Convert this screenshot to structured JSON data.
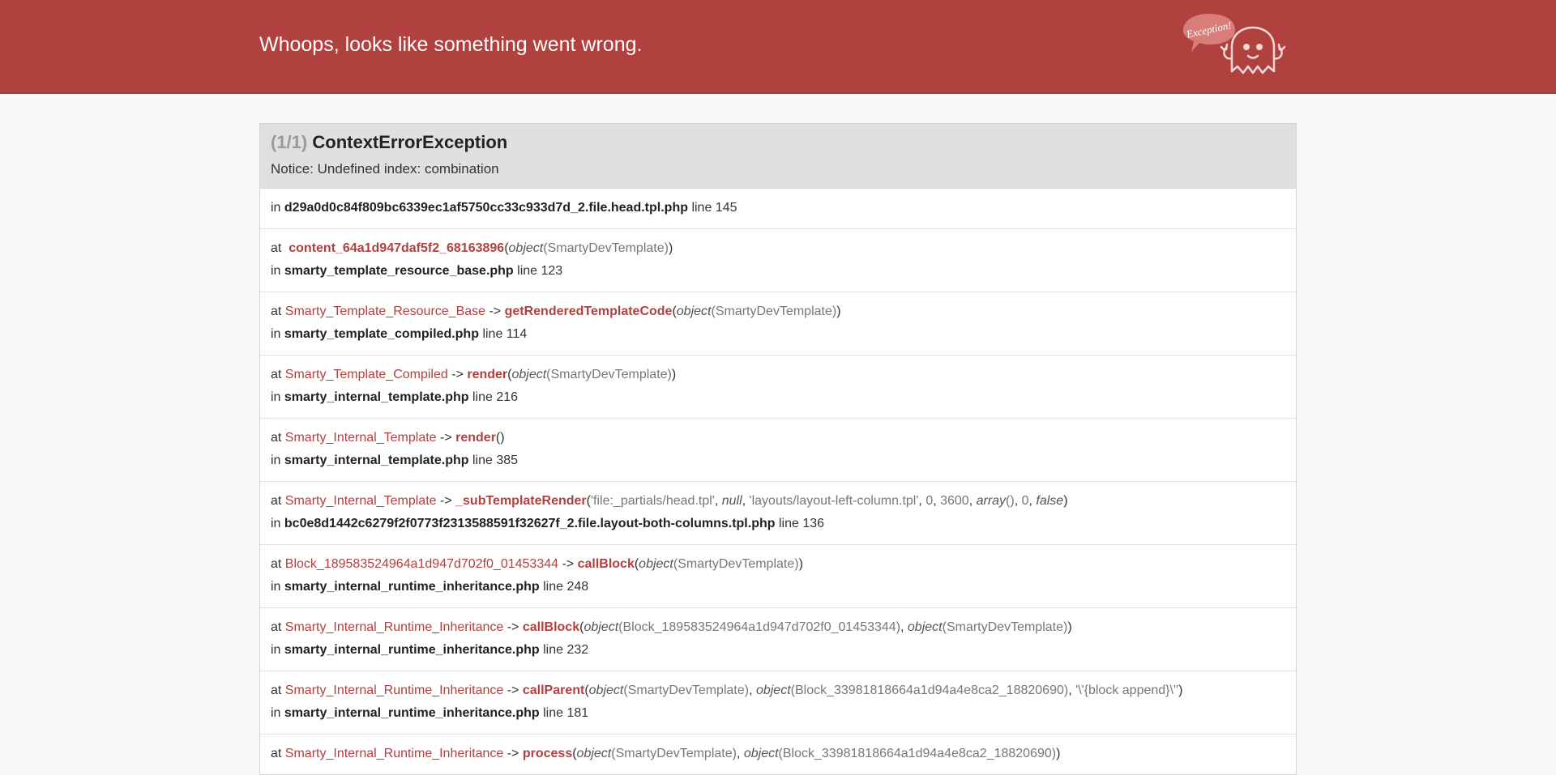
{
  "header": {
    "title": "Whoops, looks like something went wrong.",
    "mascot_bubble": "Exception!"
  },
  "exception": {
    "count": "(1/1)",
    "name": "ContextErrorException",
    "message": "Notice: Undefined index: combination"
  },
  "trace": [
    {
      "type": "in",
      "file": "d29a0d0c84f809bc6339ec1af5750cc33c933d7d_2.file.head.tpl.php",
      "line": "line 145"
    },
    {
      "type": "at",
      "cls": "",
      "fn": "content_64a1d947daf5f2_68163896",
      "args": [
        [
          "object",
          "SmartyDevTemplate"
        ]
      ],
      "file": "smarty_template_resource_base.php",
      "line": "line 123"
    },
    {
      "type": "at",
      "cls": "Smarty_Template_Resource_Base",
      "fn": "getRenderedTemplateCode",
      "args": [
        [
          "object",
          "SmartyDevTemplate"
        ]
      ],
      "file": "smarty_template_compiled.php",
      "line": "line 114"
    },
    {
      "type": "at",
      "cls": "Smarty_Template_Compiled",
      "fn": "render",
      "args": [
        [
          "object",
          "SmartyDevTemplate"
        ]
      ],
      "file": "smarty_internal_template.php",
      "line": "line 216"
    },
    {
      "type": "at",
      "cls": "Smarty_Internal_Template",
      "fn": "render",
      "args": [],
      "file": "smarty_internal_template.php",
      "line": "line 385"
    },
    {
      "type": "at",
      "cls": "Smarty_Internal_Template",
      "fn": "_subTemplateRender",
      "args": [
        [
          "",
          "'file:_partials/head.tpl'"
        ],
        [
          "null",
          ""
        ],
        [
          "",
          "'layouts/layout-left-column.tpl'"
        ],
        [
          "",
          "0"
        ],
        [
          "",
          "3600"
        ],
        [
          "array",
          "()"
        ],
        [
          "",
          "0"
        ],
        [
          "false",
          ""
        ]
      ],
      "file": "bc0e8d1442c6279f2f0773f2313588591f32627f_2.file.layout-both-columns.tpl.php",
      "line": "line 136"
    },
    {
      "type": "at",
      "cls": "Block_189583524964a1d947d702f0_01453344",
      "fn": "callBlock",
      "args": [
        [
          "object",
          "SmartyDevTemplate"
        ]
      ],
      "file": "smarty_internal_runtime_inheritance.php",
      "line": "line 248"
    },
    {
      "type": "at",
      "cls": "Smarty_Internal_Runtime_Inheritance",
      "fn": "callBlock",
      "args": [
        [
          "object",
          "Block_189583524964a1d947d702f0_01453344"
        ],
        [
          "object",
          "SmartyDevTemplate"
        ]
      ],
      "file": "smarty_internal_runtime_inheritance.php",
      "line": "line 232"
    },
    {
      "type": "at",
      "cls": "Smarty_Internal_Runtime_Inheritance",
      "fn": "callParent",
      "args": [
        [
          "object",
          "SmartyDevTemplate"
        ],
        [
          "object",
          "Block_33981818664a1d94a4e8ca2_18820690"
        ],
        [
          "",
          "'\\'{block append}\\''"
        ]
      ],
      "file": "smarty_internal_runtime_inheritance.php",
      "line": "line 181"
    },
    {
      "type": "at",
      "cls": "Smarty_Internal_Runtime_Inheritance",
      "fn": "process",
      "args": [
        [
          "object",
          "SmartyDevTemplate"
        ],
        [
          "object",
          "Block_33981818664a1d94a4e8ca2_18820690"
        ]
      ],
      "file": "",
      "line": ""
    }
  ]
}
